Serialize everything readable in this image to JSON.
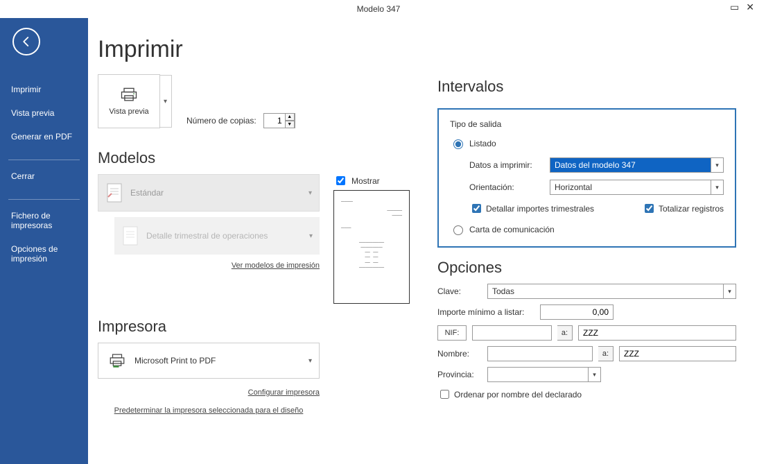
{
  "window": {
    "title": "Modelo 347"
  },
  "sidebar": {
    "items": [
      "Imprimir",
      "Vista previa",
      "Generar en PDF"
    ],
    "close": "Cerrar",
    "extra": [
      "Fichero de impresoras",
      "Opciones de impresión"
    ]
  },
  "header": "Imprimir",
  "preview": {
    "button_label": "Vista previa",
    "copies_label": "Número de copias:",
    "copies_value": "1"
  },
  "models": {
    "title": "Modelos",
    "standard": "Estándar",
    "detail": "Detalle trimestral de operaciones",
    "show_label": "Mostrar",
    "view_link": "Ver modelos de impresión"
  },
  "printer": {
    "title": "Impresora",
    "name": "Microsoft Print to PDF",
    "configure": "Configurar impresora",
    "set_default": "Predeterminar la impresora seleccionada para el diseño"
  },
  "intervals": {
    "title": "Intervalos",
    "legend": "Tipo de salida",
    "radio_list": "Listado",
    "data_label": "Datos a imprimir:",
    "data_value": "Datos del modelo 347",
    "orient_label": "Orientación:",
    "orient_value": "Horizontal",
    "chk_detail": "Detallar importes trimestrales",
    "chk_total": "Totalizar registros",
    "radio_letter": "Carta de comunicación"
  },
  "options": {
    "title": "Opciones",
    "key_label": "Clave:",
    "key_value": "Todas",
    "min_label": "Importe mínimo a listar:",
    "min_value": "0,00",
    "nif_label": "NIF:",
    "to_label": "a:",
    "nif_to": "ZZZ",
    "name_label": "Nombre:",
    "name_to": "ZZZ",
    "prov_label": "Provincia:",
    "sort_label": "Ordenar por nombre del declarado"
  }
}
